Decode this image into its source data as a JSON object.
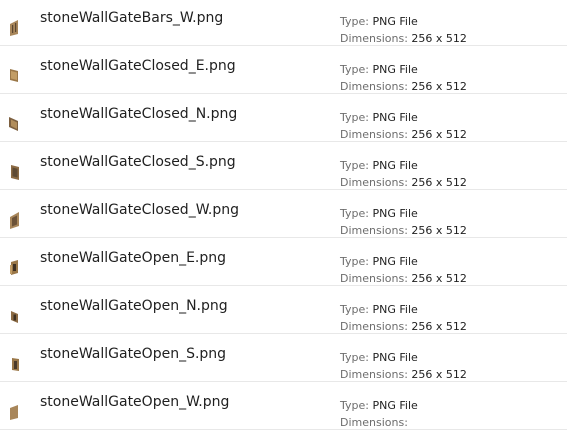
{
  "labels": {
    "type": "Type:",
    "dimensions": "Dimensions:"
  },
  "files": [
    {
      "name": "stoneWallGateBars_W.png",
      "type": "PNG File",
      "dimensions": "256 x 512",
      "icon": "bars-w-thumbnail-icon"
    },
    {
      "name": "stoneWallGateClosed_E.png",
      "type": "PNG File",
      "dimensions": "256 x 512",
      "icon": "closed-e-thumbnail-icon"
    },
    {
      "name": "stoneWallGateClosed_N.png",
      "type": "PNG File",
      "dimensions": "256 x 512",
      "icon": "closed-n-thumbnail-icon"
    },
    {
      "name": "stoneWallGateClosed_S.png",
      "type": "PNG File",
      "dimensions": "256 x 512",
      "icon": "closed-s-thumbnail-icon"
    },
    {
      "name": "stoneWallGateClosed_W.png",
      "type": "PNG File",
      "dimensions": "256 x 512",
      "icon": "closed-w-thumbnail-icon"
    },
    {
      "name": "stoneWallGateOpen_E.png",
      "type": "PNG File",
      "dimensions": "256 x 512",
      "icon": "open-e-thumbnail-icon"
    },
    {
      "name": "stoneWallGateOpen_N.png",
      "type": "PNG File",
      "dimensions": "256 x 512",
      "icon": "open-n-thumbnail-icon"
    },
    {
      "name": "stoneWallGateOpen_S.png",
      "type": "PNG File",
      "dimensions": "256 x 512",
      "icon": "open-s-thumbnail-icon"
    },
    {
      "name": "stoneWallGateOpen_W.png",
      "type": "PNG File",
      "dimensions": "",
      "icon": "open-w-thumbnail-icon"
    }
  ]
}
